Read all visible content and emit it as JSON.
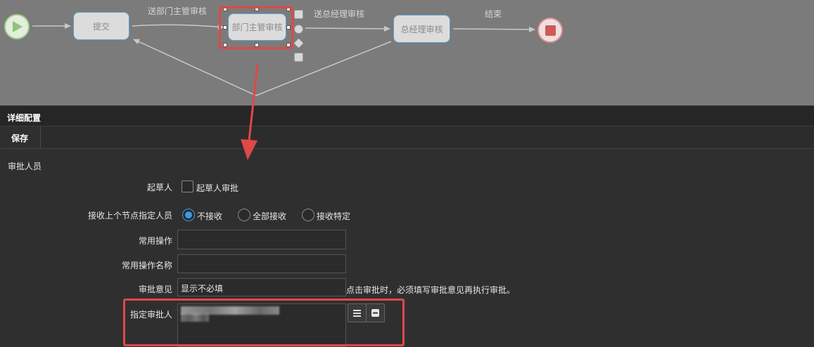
{
  "flow": {
    "nodes": {
      "submit": "提交",
      "dept_manager": "部门主管审核",
      "general_manager": "总经理审核"
    },
    "edges": {
      "to_dept_manager": "送部门主管审核",
      "to_general_manager": "送总经理审核",
      "end": "结束"
    }
  },
  "panel": {
    "header": "详细配置",
    "save_label": "保存",
    "section_title": "审批人员"
  },
  "form": {
    "drafter": {
      "label": "起草人",
      "checkbox_label": "起草人审批",
      "checked": false
    },
    "receive_prev": {
      "label": "接收上个节点指定人员",
      "options": [
        "不接收",
        "全部接收",
        "接收特定"
      ],
      "selected": "不接收"
    },
    "common_action": {
      "label": "常用操作",
      "value": ""
    },
    "common_action_name": {
      "label": "常用操作名称",
      "value": ""
    },
    "approval_opinion": {
      "label": "审批意见",
      "value": "显示不必填",
      "hint": "点击审批时，必须填写审批意见再执行审批。"
    },
    "assigned_approver": {
      "label": "指定审批人"
    }
  },
  "colors": {
    "canvas_bg": "#7b7b7b",
    "panel_bg": "#2f2f2f",
    "accent": "#3a9ae8",
    "highlight_red": "#e04848",
    "start_green": "#9ccf8f",
    "end_red": "#d05959"
  },
  "icons": {
    "start": "play-icon",
    "end": "stop-icon",
    "list_button": "list-icon",
    "remove_button": "minus-icon"
  }
}
